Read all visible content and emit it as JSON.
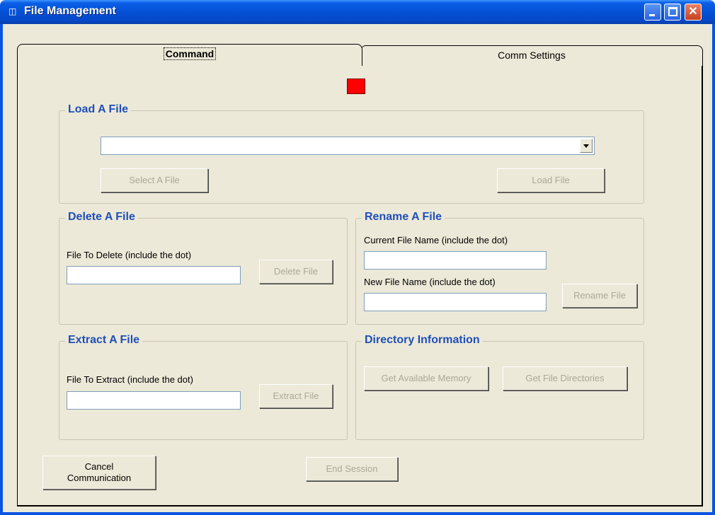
{
  "window": {
    "title": "File Management"
  },
  "tabs": {
    "command": "Command",
    "comm_settings": "Comm Settings"
  },
  "load": {
    "title": "Load A File",
    "file_value": "",
    "select_button": "Select A File",
    "load_button": "Load File"
  },
  "delete": {
    "title": "Delete A File",
    "label": "File To Delete (include the dot)",
    "value": "",
    "button": "Delete File"
  },
  "rename": {
    "title": "Rename A File",
    "current_label": "Current File Name (include the dot)",
    "current_value": "",
    "new_label": "New File Name (include the dot)",
    "new_value": "",
    "button": "Rename File"
  },
  "extract": {
    "title": "Extract A File",
    "label": "File To Extract (include the dot)",
    "value": "",
    "button": "Extract File"
  },
  "directory": {
    "title": "Directory Information",
    "memory_button": "Get Available Memory",
    "directories_button": "Get File Directories"
  },
  "footer": {
    "cancel_button_line1": "Cancel",
    "cancel_button_line2": "Communication",
    "end_button": "End Session"
  },
  "colors": {
    "indicator": "#ff0000",
    "group_title": "#1f4fb8",
    "title_bar": "#0551d6"
  }
}
